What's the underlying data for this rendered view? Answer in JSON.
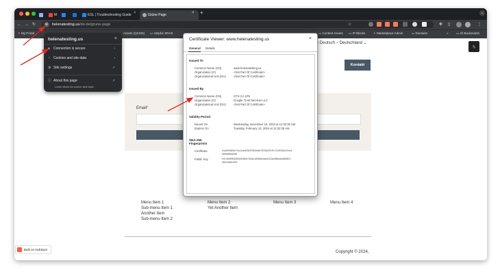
{
  "browser": {
    "tabs": [
      {
        "label": ""
      },
      {
        "label": "M"
      },
      {
        "label": ""
      },
      {
        "label": "ESL | Troubleshooting Guide"
      },
      {
        "label": "Grüne Page"
      }
    ],
    "url_host": "helenatesting.us",
    "url_path": "/de-de/grune-page",
    "bookmarks": [
      "My Portal",
      "Assets (QCMS)",
      "Helpful JIRAS",
      "Content Assets",
      "IP Blocks",
      "Marketplace Admin",
      "Domains",
      "All Bookmarks"
    ]
  },
  "site_panel": {
    "title": "helenatesting.us",
    "rows": [
      {
        "icon": "lock-icon",
        "label": "Connection is secure"
      },
      {
        "icon": "cookie-icon",
        "label": "Cookies and site data"
      },
      {
        "icon": "settings-icon",
        "label": "Site settings"
      }
    ],
    "about_title": "About this page",
    "about_sub": "Learn about its source and topic"
  },
  "cert": {
    "title": "Certificate Viewer: www.helenatesting.us",
    "tabs": [
      "General",
      "Details"
    ],
    "issued_to_heading": "Issued To",
    "issued_to": [
      {
        "k": "Common Name (CN)",
        "v": "www.helenatesting.us"
      },
      {
        "k": "Organization (O)",
        "v": "<Not Part Of Certificate>"
      },
      {
        "k": "Organizational Unit (OU)",
        "v": "<Not Part Of Certificate>"
      }
    ],
    "issued_by_heading": "Issued By",
    "issued_by": [
      {
        "k": "Common Name (CN)",
        "v": "GTS CA 1P5"
      },
      {
        "k": "Organization (O)",
        "v": "Google Trust Services LLC"
      },
      {
        "k": "Organizational Unit (OU)",
        "v": "<Not Part Of Certificate>"
      }
    ],
    "validity_heading": "Validity Period",
    "validity": [
      {
        "k": "Issued On",
        "v": "Wednesday, November 15, 2023 at 12:32:30 AM"
      },
      {
        "k": "Expires On",
        "v": "Tuesday, February 13, 2024 at 12:32:29 AM"
      }
    ],
    "fp_heading_1": "SHA-256",
    "fp_heading_2": "Fingerprints",
    "fp": [
      {
        "k": "Certificate",
        "v1": "41a909883e74cc1ae53f420502a9b7878d37b7b71490362a7be4",
        "v2": "e8098fbfd096"
      },
      {
        "k": "Public Key",
        "v1": "e47c8d9f53d5fd494fbe7d3a13d068b3dcb012ac58ba4dd50821",
        "v2": "08419a0c3f21"
      }
    ]
  },
  "page": {
    "language": "Deutsch – Deutschland",
    "kontakt": "Kontakt",
    "email_label": "Email",
    "email_req": "*",
    "menus": [
      {
        "lines": [
          "Menu Item 1",
          "Sub-menu Item 1",
          "Another Item",
          "Sub-menu Item 2"
        ]
      },
      {
        "lines": [
          "Menu Item 2",
          "Yet Another Item"
        ]
      },
      {
        "lines": [
          "Menu Item 3"
        ]
      },
      {
        "lines": [
          "Menu Item 4"
        ]
      }
    ],
    "copyright": "Copyright © 2024,",
    "built_on": "Built on HubSpot"
  }
}
